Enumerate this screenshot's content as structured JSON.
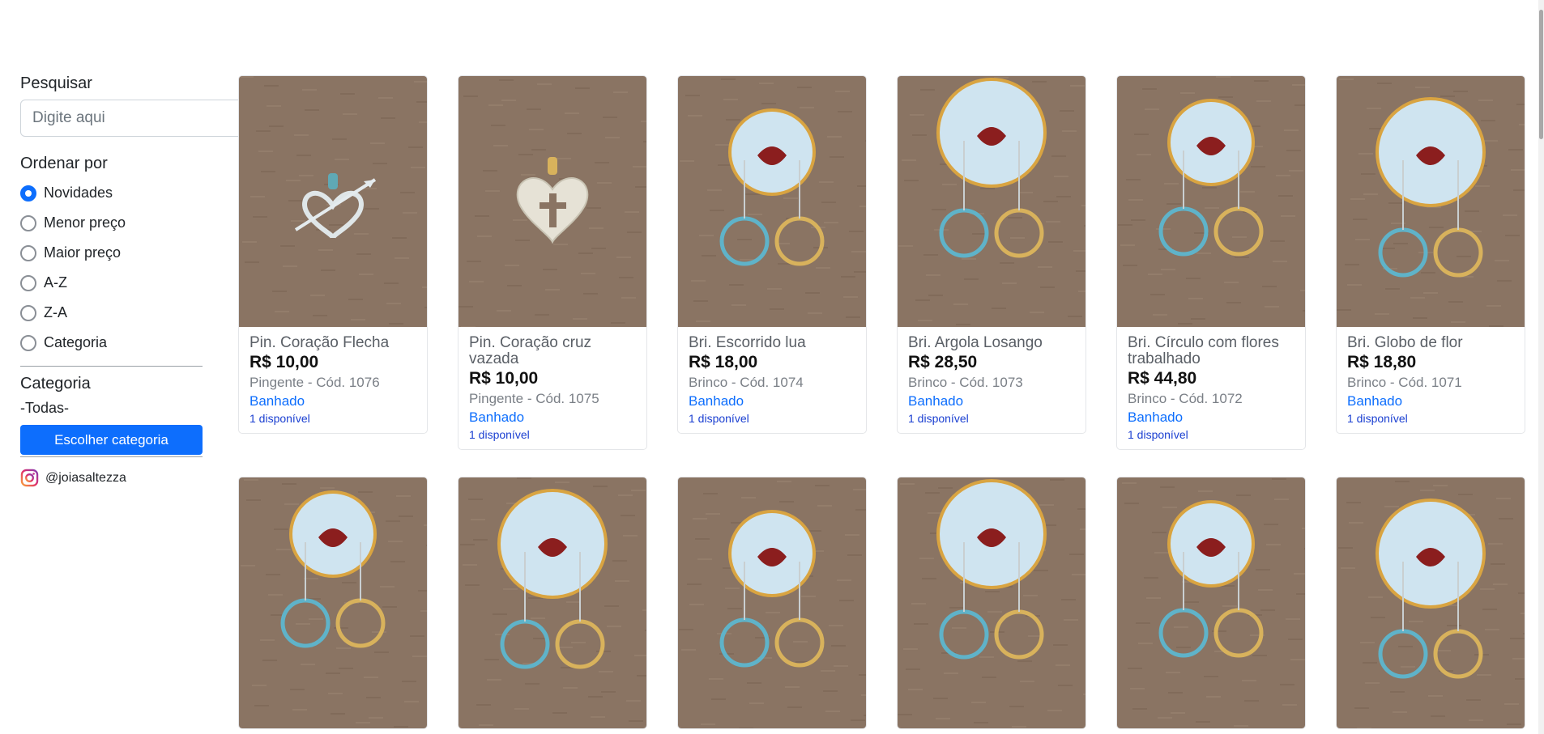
{
  "sidebar": {
    "search_title": "Pesquisar",
    "search_placeholder": "Digite aqui",
    "order_title": "Ordenar por",
    "order_options": [
      {
        "label": "Novidades",
        "checked": true
      },
      {
        "label": "Menor preço",
        "checked": false
      },
      {
        "label": "Maior preço",
        "checked": false
      },
      {
        "label": "A-Z",
        "checked": false
      },
      {
        "label": "Z-A",
        "checked": false
      },
      {
        "label": "Categoria",
        "checked": false
      }
    ],
    "category_title": "Categoria",
    "category_value": "-Todas-",
    "category_button": "Escolher categoria",
    "instagram": "@joiasaltezza"
  },
  "products": [
    {
      "name": "Pin. Coração Flecha",
      "price": "R$ 10,00",
      "code": "Pingente - Cód. 1076",
      "type": "Banhado",
      "stock": "1 disponível",
      "kind": "pendant-heart-arrow"
    },
    {
      "name": "Pin. Coração cruz vazada",
      "price": "R$ 10,00",
      "code": "Pingente - Cód. 1075",
      "type": "Banhado",
      "stock": "1 disponível",
      "kind": "pendant-heart-cross"
    },
    {
      "name": "Bri. Escorrido lua",
      "price": "R$ 18,00",
      "code": "Brinco - Cód. 1074",
      "type": "Banhado",
      "stock": "1 disponível",
      "kind": "earring-card"
    },
    {
      "name": "Bri. Argola Losango",
      "price": "R$ 28,50",
      "code": "Brinco - Cód. 1073",
      "type": "Banhado",
      "stock": "1 disponível",
      "kind": "earring-card"
    },
    {
      "name": "Bri. Círculo com flores trabalhado",
      "price": "R$ 44,80",
      "code": "Brinco - Cód. 1072",
      "type": "Banhado",
      "stock": "1 disponível",
      "kind": "earring-card"
    },
    {
      "name": "Bri. Globo de flor",
      "price": "R$ 18,80",
      "code": "Brinco - Cód. 1071",
      "type": "Banhado",
      "stock": "1 disponível",
      "kind": "earring-card"
    },
    {
      "kind": "earring-card"
    },
    {
      "kind": "earring-card"
    },
    {
      "kind": "earring-card"
    },
    {
      "kind": "earring-card"
    },
    {
      "kind": "earring-card"
    },
    {
      "kind": "earring-card"
    }
  ],
  "colors": {
    "accent": "#0d6efd",
    "photo_bg": "#8a7463",
    "card_disc": "#cfe4f0",
    "jewel_teal": "#5fb3c9",
    "jewel_gold": "#d8b25c"
  }
}
